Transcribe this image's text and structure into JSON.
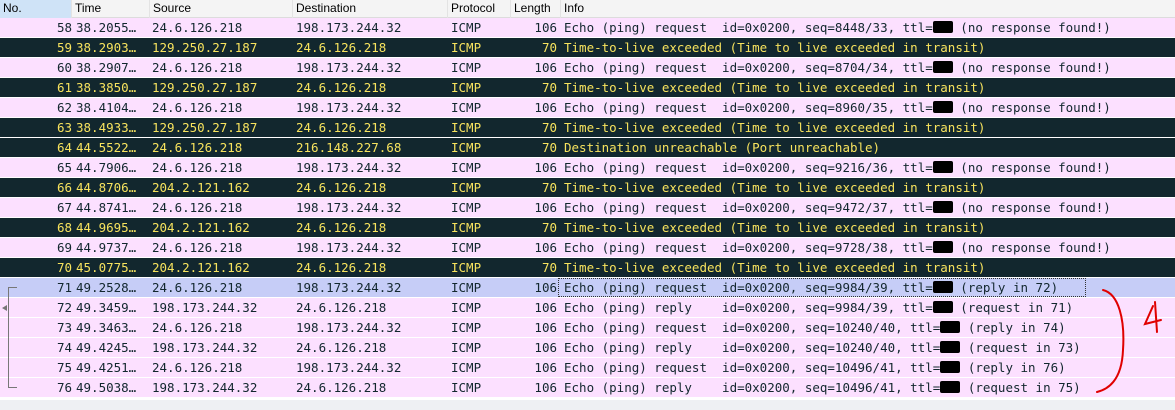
{
  "columns": [
    "No.",
    "Time",
    "Source",
    "Destination",
    "Protocol",
    "Length",
    "Info"
  ],
  "colors": {
    "request_bg": "#fce0ff",
    "request_fg": "#12272e",
    "ttl_bg": "#12272e",
    "ttl_fg": "#f7e35e",
    "selected_bg": "#c6cdf7",
    "annotation": "#e00000"
  },
  "rows": [
    {
      "no": "58",
      "time": "38.2055…",
      "src": "24.6.126.218",
      "dst": "198.173.244.32",
      "proto": "ICMP",
      "len": "106",
      "info": "Echo (ping) request  id=0x0200, seq=8448/33, ttl=",
      "tail": " (no response found!)",
      "kind": "request",
      "redact": true
    },
    {
      "no": "59",
      "time": "38.2903…",
      "src": "129.250.27.187",
      "dst": "24.6.126.218",
      "proto": "ICMP",
      "len": "70",
      "info": "Time-to-live exceeded (Time to live exceeded in transit)",
      "tail": "",
      "kind": "ttl",
      "redact": false
    },
    {
      "no": "60",
      "time": "38.2907…",
      "src": "24.6.126.218",
      "dst": "198.173.244.32",
      "proto": "ICMP",
      "len": "106",
      "info": "Echo (ping) request  id=0x0200, seq=8704/34, ttl=",
      "tail": " (no response found!)",
      "kind": "request",
      "redact": true
    },
    {
      "no": "61",
      "time": "38.3850…",
      "src": "129.250.27.187",
      "dst": "24.6.126.218",
      "proto": "ICMP",
      "len": "70",
      "info": "Time-to-live exceeded (Time to live exceeded in transit)",
      "tail": "",
      "kind": "ttl",
      "redact": false
    },
    {
      "no": "62",
      "time": "38.4104…",
      "src": "24.6.126.218",
      "dst": "198.173.244.32",
      "proto": "ICMP",
      "len": "106",
      "info": "Echo (ping) request  id=0x0200, seq=8960/35, ttl=",
      "tail": " (no response found!)",
      "kind": "request",
      "redact": true
    },
    {
      "no": "63",
      "time": "38.4933…",
      "src": "129.250.27.187",
      "dst": "24.6.126.218",
      "proto": "ICMP",
      "len": "70",
      "info": "Time-to-live exceeded (Time to live exceeded in transit)",
      "tail": "",
      "kind": "ttl",
      "redact": false
    },
    {
      "no": "64",
      "time": "44.5522…",
      "src": "24.6.126.218",
      "dst": "216.148.227.68",
      "proto": "ICMP",
      "len": "70",
      "info": "Destination unreachable (Port unreachable)",
      "tail": "",
      "kind": "ttl",
      "redact": false
    },
    {
      "no": "65",
      "time": "44.7906…",
      "src": "24.6.126.218",
      "dst": "198.173.244.32",
      "proto": "ICMP",
      "len": "106",
      "info": "Echo (ping) request  id=0x0200, seq=9216/36, ttl=",
      "tail": " (no response found!)",
      "kind": "request",
      "redact": true
    },
    {
      "no": "66",
      "time": "44.8706…",
      "src": "204.2.121.162",
      "dst": "24.6.126.218",
      "proto": "ICMP",
      "len": "70",
      "info": "Time-to-live exceeded (Time to live exceeded in transit)",
      "tail": "",
      "kind": "ttl",
      "redact": false
    },
    {
      "no": "67",
      "time": "44.8741…",
      "src": "24.6.126.218",
      "dst": "198.173.244.32",
      "proto": "ICMP",
      "len": "106",
      "info": "Echo (ping) request  id=0x0200, seq=9472/37, ttl=",
      "tail": " (no response found!)",
      "kind": "request",
      "redact": true
    },
    {
      "no": "68",
      "time": "44.9695…",
      "src": "204.2.121.162",
      "dst": "24.6.126.218",
      "proto": "ICMP",
      "len": "70",
      "info": "Time-to-live exceeded (Time to live exceeded in transit)",
      "tail": "",
      "kind": "ttl",
      "redact": false
    },
    {
      "no": "69",
      "time": "44.9737…",
      "src": "24.6.126.218",
      "dst": "198.173.244.32",
      "proto": "ICMP",
      "len": "106",
      "info": "Echo (ping) request  id=0x0200, seq=9728/38, ttl=",
      "tail": " (no response found!)",
      "kind": "request",
      "redact": true
    },
    {
      "no": "70",
      "time": "45.0775…",
      "src": "204.2.121.162",
      "dst": "24.6.126.218",
      "proto": "ICMP",
      "len": "70",
      "info": "Time-to-live exceeded (Time to live exceeded in transit)",
      "tail": "",
      "kind": "ttl",
      "redact": false
    },
    {
      "no": "71",
      "time": "49.2528…",
      "src": "24.6.126.218",
      "dst": "198.173.244.32",
      "proto": "ICMP",
      "len": "106",
      "info": "Echo (ping) request  id=0x0200, seq=9984/39, ttl=",
      "tail": " (reply in 72)",
      "kind": "selected",
      "redact": true
    },
    {
      "no": "72",
      "time": "49.3459…",
      "src": "198.173.244.32",
      "dst": "24.6.126.218",
      "proto": "ICMP",
      "len": "106",
      "info": "Echo (ping) reply    id=0x0200, seq=9984/39, ttl=",
      "tail": " (request in 71)",
      "kind": "request",
      "redact": true
    },
    {
      "no": "73",
      "time": "49.3463…",
      "src": "24.6.126.218",
      "dst": "198.173.244.32",
      "proto": "ICMP",
      "len": "106",
      "info": "Echo (ping) request  id=0x0200, seq=10240/40, ttl=",
      "tail": " (reply in 74)",
      "kind": "request",
      "redact": true
    },
    {
      "no": "74",
      "time": "49.4245…",
      "src": "198.173.244.32",
      "dst": "24.6.126.218",
      "proto": "ICMP",
      "len": "106",
      "info": "Echo (ping) reply    id=0x0200, seq=10240/40, ttl=",
      "tail": " (request in 73)",
      "kind": "request",
      "redact": true
    },
    {
      "no": "75",
      "time": "49.4251…",
      "src": "24.6.126.218",
      "dst": "198.173.244.32",
      "proto": "ICMP",
      "len": "106",
      "info": "Echo (ping) request  id=0x0200, seq=10496/41, ttl=",
      "tail": " (reply in 76)",
      "kind": "request",
      "redact": true
    },
    {
      "no": "76",
      "time": "49.5038…",
      "src": "198.173.244.32",
      "dst": "24.6.126.218",
      "proto": "ICMP",
      "len": "106",
      "info": "Echo (ping) reply    id=0x0200, seq=10496/41, ttl=",
      "tail": " (request in 75)",
      "kind": "request",
      "redact": true
    }
  ]
}
